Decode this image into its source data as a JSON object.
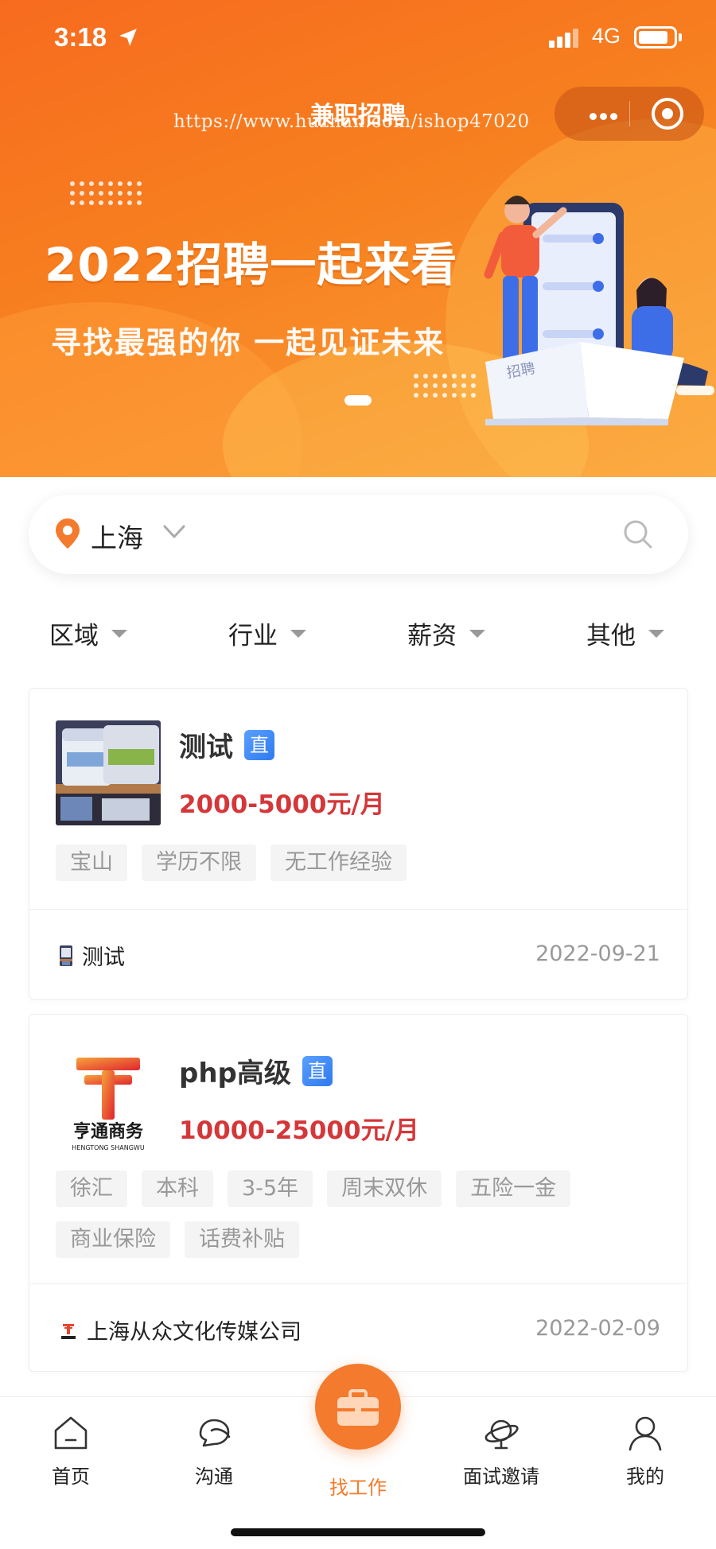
{
  "status_bar": {
    "time": "3:18",
    "network": "4G"
  },
  "nav": {
    "title": "兼职招聘",
    "watermark": "https://www.huzhan.com/ishop47020"
  },
  "banner": {
    "headline": "2022招聘一起来看",
    "subline": "寻找最强的你  一起见证未来",
    "book_label": "招聘"
  },
  "search": {
    "city": "上海"
  },
  "filters": [
    {
      "label": "区域"
    },
    {
      "label": "行业"
    },
    {
      "label": "薪资"
    },
    {
      "label": "其他"
    }
  ],
  "jobs": [
    {
      "title": "测试",
      "badge": "直",
      "salary": "2000-5000元/月",
      "tags": [
        "宝山",
        "学历不限",
        "无工作经验"
      ],
      "company": "测试",
      "date": "2022-09-21"
    },
    {
      "title": "php高级",
      "badge": "直",
      "salary": "10000-25000元/月",
      "tags": [
        "徐汇",
        "本科",
        "3-5年",
        "周末双休",
        "五险一金",
        "商业保险",
        "话费补贴"
      ],
      "company": "上海从众文化传媒公司",
      "date": "2022-02-09",
      "logo_text": "亨通商务",
      "logo_subtext": "HENGTONG SHANGWU"
    }
  ],
  "tabbar": [
    {
      "label": "首页",
      "icon": "home-icon"
    },
    {
      "label": "沟通",
      "icon": "chat-icon"
    },
    {
      "label": "找工作",
      "icon": "briefcase-icon",
      "active": true
    },
    {
      "label": "面试邀请",
      "icon": "interview-icon"
    },
    {
      "label": "我的",
      "icon": "user-icon"
    }
  ],
  "colors": {
    "brand": "#f47a2d",
    "salary": "#d4373a",
    "badge": "#2f79f0",
    "tag_bg": "#f4f4f4"
  }
}
